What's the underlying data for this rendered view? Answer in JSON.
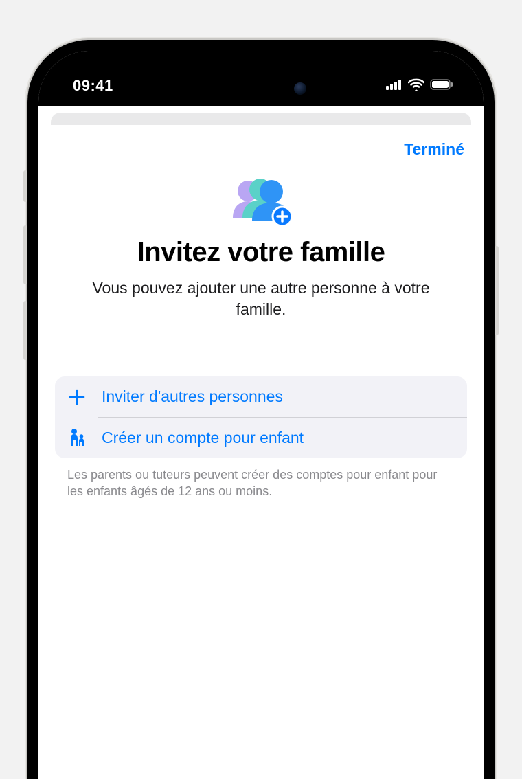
{
  "status": {
    "time": "09:41"
  },
  "sheet": {
    "done_label": "Terminé",
    "title": "Invitez votre famille",
    "subtitle": "Vous pouvez ajouter une autre personne à votre famille."
  },
  "options": {
    "invite": {
      "label": "Inviter d'autres personnes",
      "icon": "plus-icon"
    },
    "create_child": {
      "label": "Créer un compte pour enfant",
      "icon": "parent-child-icon"
    }
  },
  "footer_note": "Les parents ou tuteurs peuvent créer des comptes pour enfant pour les enfants âgés de 12 ans ou moins.",
  "colors": {
    "accent": "#007aff",
    "background": "#ffffff",
    "option_bg": "#f2f2f7",
    "secondary_text": "#8a8a8e"
  }
}
